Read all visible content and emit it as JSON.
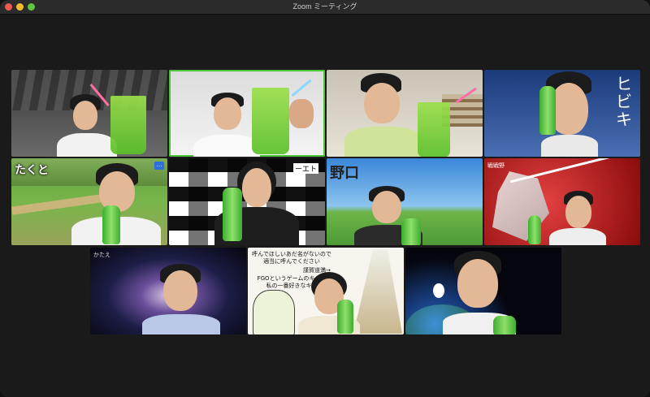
{
  "window": {
    "title": "Zoom ミーティング"
  },
  "tiles": [
    {
      "name": "",
      "active": false
    },
    {
      "name": "",
      "active": true
    },
    {
      "name": "",
      "active": false
    },
    {
      "name": "ヒビキ",
      "active": false
    },
    {
      "name": "たくと",
      "active": false,
      "more": "…"
    },
    {
      "name": "",
      "active": false,
      "banner": "ーエト"
    },
    {
      "name": "野口",
      "active": false
    },
    {
      "name": "",
      "active": false,
      "banner": "戦戦野"
    },
    {
      "name": "",
      "active": false,
      "badge": "かたえ"
    },
    {
      "name": "",
      "active": false,
      "speech1": "呼んでほしいあだ名がないので",
      "speech2": "適当に呼んでください",
      "speech3": "FGOというゲームのキャラ",
      "speech4": "私の一番好きなキャ",
      "speech5": "謹賀道満→"
    },
    {
      "name": "",
      "active": false
    }
  ],
  "colors": {
    "accent_active": "#4dc53a"
  }
}
